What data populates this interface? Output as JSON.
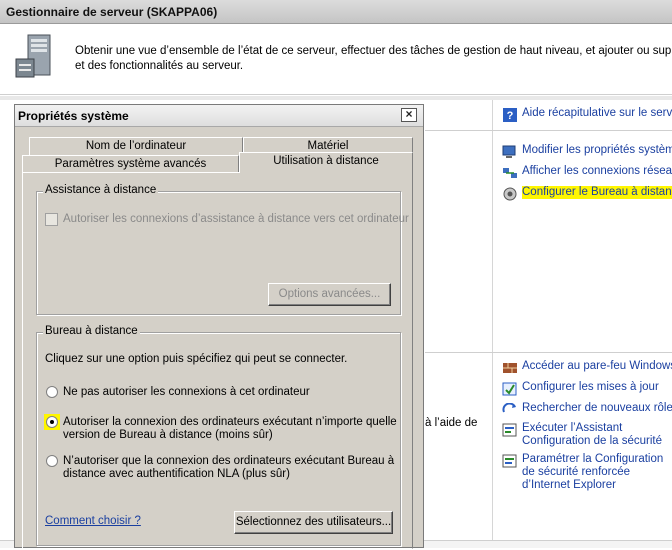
{
  "server_manager": {
    "title": "Gestionnaire de serveur (SKAPPA06)",
    "description_line1": "Obtenir une vue d’ensemble de l’état de ce serveur, effectuer des tâches de gestion de haut niveau, et ajouter ou supprimer",
    "description_line2": "et des fonctionnalités au serveur.",
    "fragment_text": "à l’aide de",
    "help_link": "Aide récapitulative sur le serveur",
    "links_group1": [
      {
        "label": "Modifier les propriétés système",
        "icon": "computer-icon"
      },
      {
        "label": "Afficher les connexions réseau",
        "icon": "network-icon"
      },
      {
        "label": "Configurer le Bureau à distance",
        "icon": "remote-desktop-icon",
        "highlight_color": "#fff600"
      }
    ],
    "links_group2": [
      {
        "label": "Accéder au pare-feu Windows",
        "icon": "firewall-icon"
      },
      {
        "label": "Configurer les mises à jour",
        "icon": "update-icon"
      },
      {
        "label": "Rechercher de nouveaux rôles",
        "icon": "search-roles-icon"
      },
      {
        "label": "Exécuter l’Assistant Configuration de la sécurité",
        "icon": "security-wizard-icon"
      },
      {
        "label": "Paramétrer la Configuration de sécurité renforcée d’Internet Explorer",
        "icon": "ie-security-icon"
      }
    ],
    "bottom_dots": "''''"
  },
  "dialog": {
    "title": "Propriétés système",
    "close_label": "×",
    "tabs_row1": [
      "Nom de l’ordinateur",
      "Matériel"
    ],
    "tabs_row2": [
      "Paramètres système avancés",
      "Utilisation à distance"
    ],
    "active_tab": "Utilisation à distance",
    "assistance": {
      "legend": "Assistance à distance",
      "checkbox_label": "Autoriser les connexions d’assistance à distance vers cet ordinateur",
      "checkbox_checked": false,
      "advanced_button": "Options avancées..."
    },
    "remote_desktop": {
      "legend": "Bureau à distance",
      "instruction": "Cliquez sur une option puis spécifiez qui peut se connecter.",
      "option1": "Ne pas autoriser les connexions à cet ordinateur",
      "option2_line1": "Autoriser la connexion des ordinateurs exécutant n’importe quelle",
      "option2_line2": "version de Bureau à distance (moins sûr)",
      "option3_line1": "N’autoriser que la connexion des ordinateurs exécutant Bureau à",
      "option3_line2": "distance avec authentification NLA (plus sûr)",
      "selected_option": 2,
      "help_link": "Comment choisir ?",
      "select_users_button": "Sélectionnez des utilisateurs..."
    }
  },
  "colors": {
    "link": "#1a3fa0",
    "highlight": "#fff600",
    "dialog_bg": "#d4d0c8"
  }
}
